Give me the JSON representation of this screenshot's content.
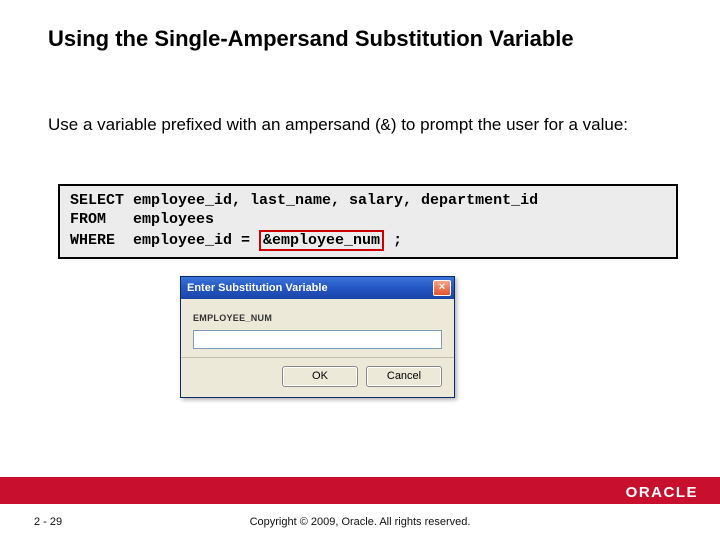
{
  "title": "Using the Single-Ampersand Substitution Variable",
  "description_pre": "Use a variable prefixed with an ampersand (",
  "description_amp": "&",
  "description_post": ") to prompt the user for a value:",
  "code": {
    "line1a": "SELECT employee_id, last_name, salary, department_id",
    "line2a": "FROM   employees",
    "line3a": "WHERE  employee_id = ",
    "line3_hl": "&employee_num",
    "line3b": " ;"
  },
  "dialog": {
    "title": "Enter Substitution Variable",
    "close": "×",
    "label": "EMPLOYEE_NUM",
    "ok": "OK",
    "cancel": "Cancel"
  },
  "footer": {
    "page": "2 - 29",
    "copyright": "Copyright © 2009, Oracle. All rights reserved.",
    "logo": "ORACLE"
  }
}
